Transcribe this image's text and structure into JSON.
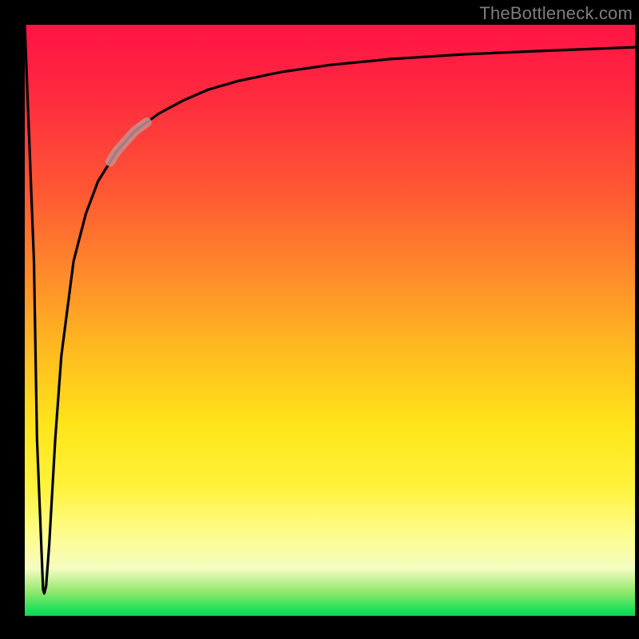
{
  "watermark": "TheBottleneck.com",
  "chart_data": {
    "type": "line",
    "title": "",
    "xlabel": "",
    "ylabel": "",
    "xlim": [
      0,
      100
    ],
    "ylim": [
      0,
      100
    ],
    "grid": false,
    "legend": false,
    "series": [
      {
        "name": "bottleneck-curve",
        "x": [
          0,
          1.5,
          2.0,
          3.0,
          3.2,
          3.5,
          4.0,
          5.0,
          6.0,
          8.0,
          10.0,
          12.0,
          15.0,
          18.0,
          22.0,
          26.0,
          30.0,
          35.0,
          42.0,
          50.0,
          60.0,
          72.0,
          85.0,
          100.0
        ],
        "y": [
          100,
          60,
          30,
          4.5,
          3.8,
          5.0,
          12.0,
          30.0,
          44.0,
          60.0,
          68.0,
          73.5,
          78.5,
          82.0,
          85.0,
          87.2,
          89.0,
          90.5,
          92.0,
          93.2,
          94.2,
          95.0,
          95.6,
          96.2
        ]
      }
    ],
    "highlight": {
      "x_start": 14.0,
      "x_end": 20.0,
      "color": "#c49090",
      "width": 12
    },
    "background_gradient": {
      "top": "#ff1744",
      "mid_upper": "#ff8a2b",
      "mid": "#ffe51a",
      "mid_lower": "#f5fcc0",
      "bottom": "#0ad850"
    }
  }
}
